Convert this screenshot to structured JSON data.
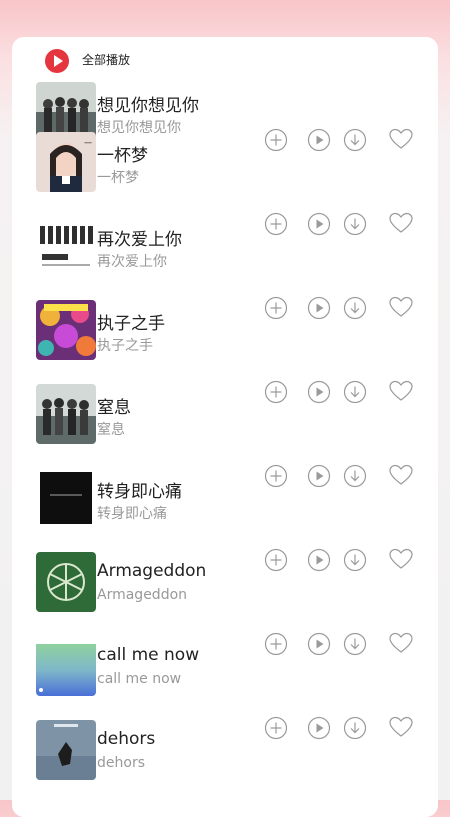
{
  "header": {
    "play_all_label": "全部播放",
    "play_all_icon": "play-circle-icon",
    "accent": "#e5353f"
  },
  "songs": [
    {
      "title": "想见你想见你",
      "subtitle": "想见你想见你",
      "cover_icon": "album-cover-group",
      "partial": true
    },
    {
      "title": "一杯梦",
      "subtitle": "一杯梦",
      "cover_icon": "album-cover-portrait"
    },
    {
      "title": "再次爱上你",
      "subtitle": "再次爱上你",
      "cover_icon": "album-cover-group-white"
    },
    {
      "title": "执子之手",
      "subtitle": "执子之手",
      "cover_icon": "album-cover-colorful"
    },
    {
      "title": "窒息",
      "subtitle": "窒息",
      "cover_icon": "album-cover-group"
    },
    {
      "title": "转身即心痛",
      "subtitle": "转身即心痛",
      "cover_icon": "album-cover-dark"
    },
    {
      "title": "Armageddon",
      "subtitle": "Armageddon",
      "cover_icon": "album-cover-green-symbol"
    },
    {
      "title": "call me now",
      "subtitle": "call me now",
      "cover_icon": "album-cover-gradient"
    },
    {
      "title": "dehors",
      "subtitle": "dehors",
      "cover_icon": "album-cover-blue"
    }
  ],
  "row_actions": [
    "add-icon",
    "play-icon",
    "download-icon",
    "heart-icon"
  ],
  "colors": {
    "icon_stroke": "#9a9a9a",
    "title": "#222222",
    "subtitle": "#999999"
  }
}
